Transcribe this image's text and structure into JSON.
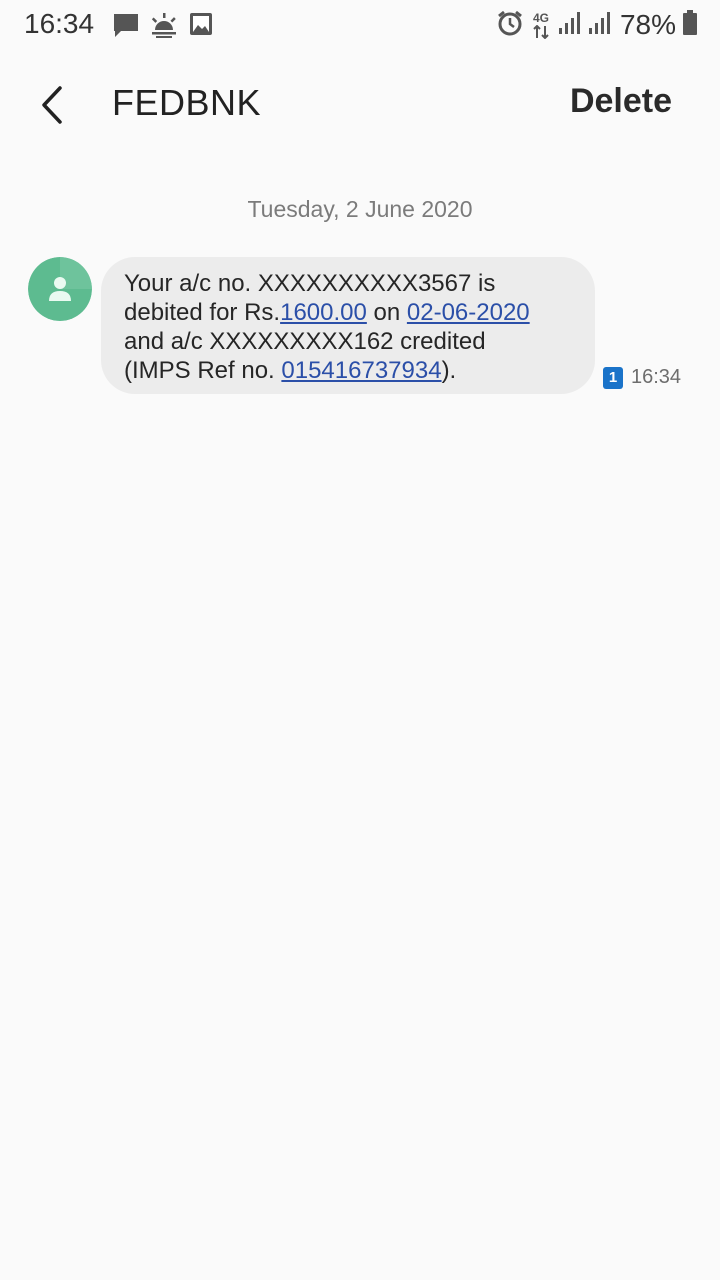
{
  "status_bar": {
    "time": "16:34",
    "icons": [
      "chat-notification-icon",
      "weather-sunrise-icon",
      "image-notification-icon",
      "alarm-icon",
      "network-4g-icon",
      "signal-icon",
      "signal-icon",
      "battery-icon"
    ],
    "network_type": "4G",
    "battery_percent": "78%"
  },
  "header": {
    "title": "FEDBNK",
    "delete_label": "Delete"
  },
  "conversation": {
    "date_divider": "Tuesday, 2 June 2020",
    "messages": [
      {
        "line1": "Your a/c no. XXXXXXXXXX3567 is",
        "line2_prefix": "debited for Rs.",
        "amount": "1600.00",
        "line2_mid": " on ",
        "date": "02-06-2020",
        "line3": "and a/c XXXXXXXXX162 credited",
        "line4_prefix": "(IMPS Ref no. ",
        "ref_no": "015416737934",
        "line4_suffix": ").",
        "sim_slot": "1",
        "time": "16:34"
      }
    ]
  },
  "colors": {
    "background": "#fafafa",
    "bubble": "#ececec",
    "link": "#2b4fa8",
    "sim_badge": "#1a73c9",
    "avatar": "#5dbb90"
  }
}
